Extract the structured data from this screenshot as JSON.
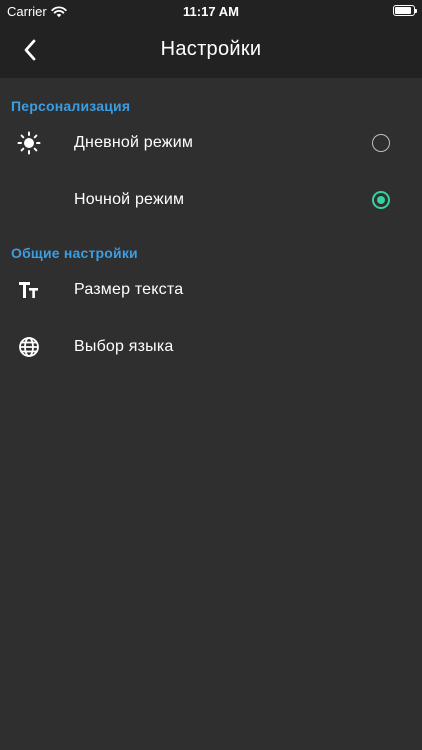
{
  "status_bar": {
    "carrier": "Carrier",
    "time": "11:17 AM",
    "wifi_icon": "wifi-icon",
    "battery_icon": "battery-icon"
  },
  "nav": {
    "back_icon": "chevron-left-icon",
    "title": "Настройки"
  },
  "sections": [
    {
      "header": "Персонализация",
      "items": [
        {
          "icon": "sun-icon",
          "label": "Дневной режим",
          "selected": false
        },
        {
          "icon": "moon-icon",
          "label": "Ночной режим",
          "selected": true
        }
      ]
    },
    {
      "header": "Общие настройки",
      "items": [
        {
          "icon": "text-size-icon",
          "label": "Размер текста"
        },
        {
          "icon": "globe-icon",
          "label": "Выбор языка"
        }
      ]
    }
  ],
  "colors": {
    "background": "#2f2f2f",
    "header_background": "#222222",
    "section_header": "#3b9de2",
    "radio_selected": "#34d3a1"
  }
}
